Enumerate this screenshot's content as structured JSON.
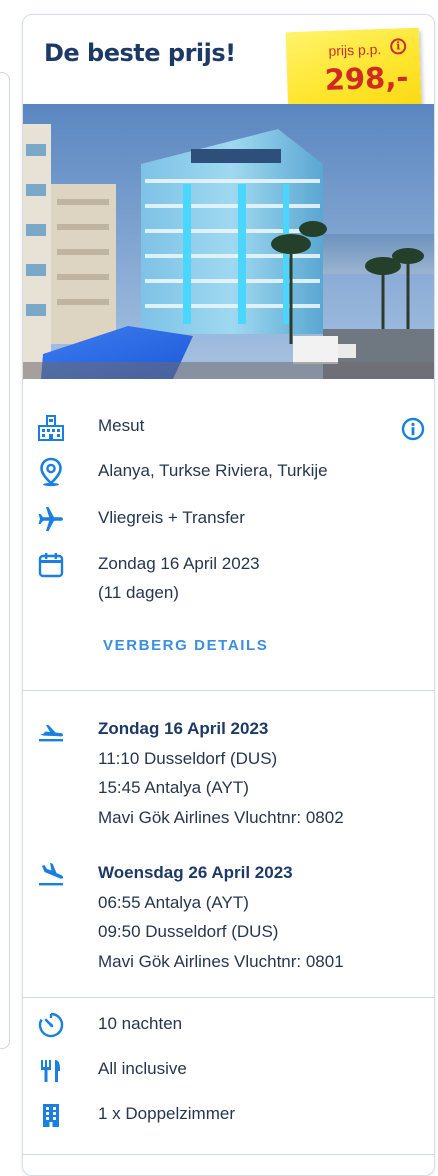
{
  "card": {
    "title": "De beste prijs!",
    "price_label": "prijs p.p.",
    "price_value": "298,-"
  },
  "summary": {
    "hotel": "Mesut",
    "location": "Alanya, Turkse Riviera, Turkije",
    "travel_type": "Vliegreis + Transfer",
    "date": "Zondag 16 April 2023",
    "duration": "(11 dagen)"
  },
  "details_toggle": "VERBERG DETAILS",
  "outbound": {
    "date": "Zondag 16 April 2023",
    "departure": "11:10 Dusseldorf (DUS)",
    "arrival": "15:45 Antalya (AYT)",
    "airline": "Mavi Gök Airlines Vluchtnr: 0802"
  },
  "return": {
    "date": "Woensdag 26 April 2023",
    "departure": "06:55 Antalya (AYT)",
    "arrival": "09:50 Dusseldorf (DUS)",
    "airline": "Mavi Gök Airlines Vluchtnr: 0801"
  },
  "extras": {
    "nights": "10 nachten",
    "board": "All inclusive",
    "room": "1 x Doppelzimmer"
  },
  "icons": {
    "hotel": "hotel-building-icon",
    "location": "location-pin-icon",
    "travel": "airplane-icon",
    "date": "calendar-icon",
    "info": "info-circle-icon",
    "departure": "plane-departure-icon",
    "arrival": "plane-arrival-icon",
    "nights": "timer-icon",
    "board": "cutlery-icon",
    "room": "room-building-icon"
  },
  "colors": {
    "accent": "#1a7fe0",
    "title": "#1d3966",
    "price": "#cf2b23",
    "sticker": "#ffe630",
    "link": "#3b8fe0"
  }
}
